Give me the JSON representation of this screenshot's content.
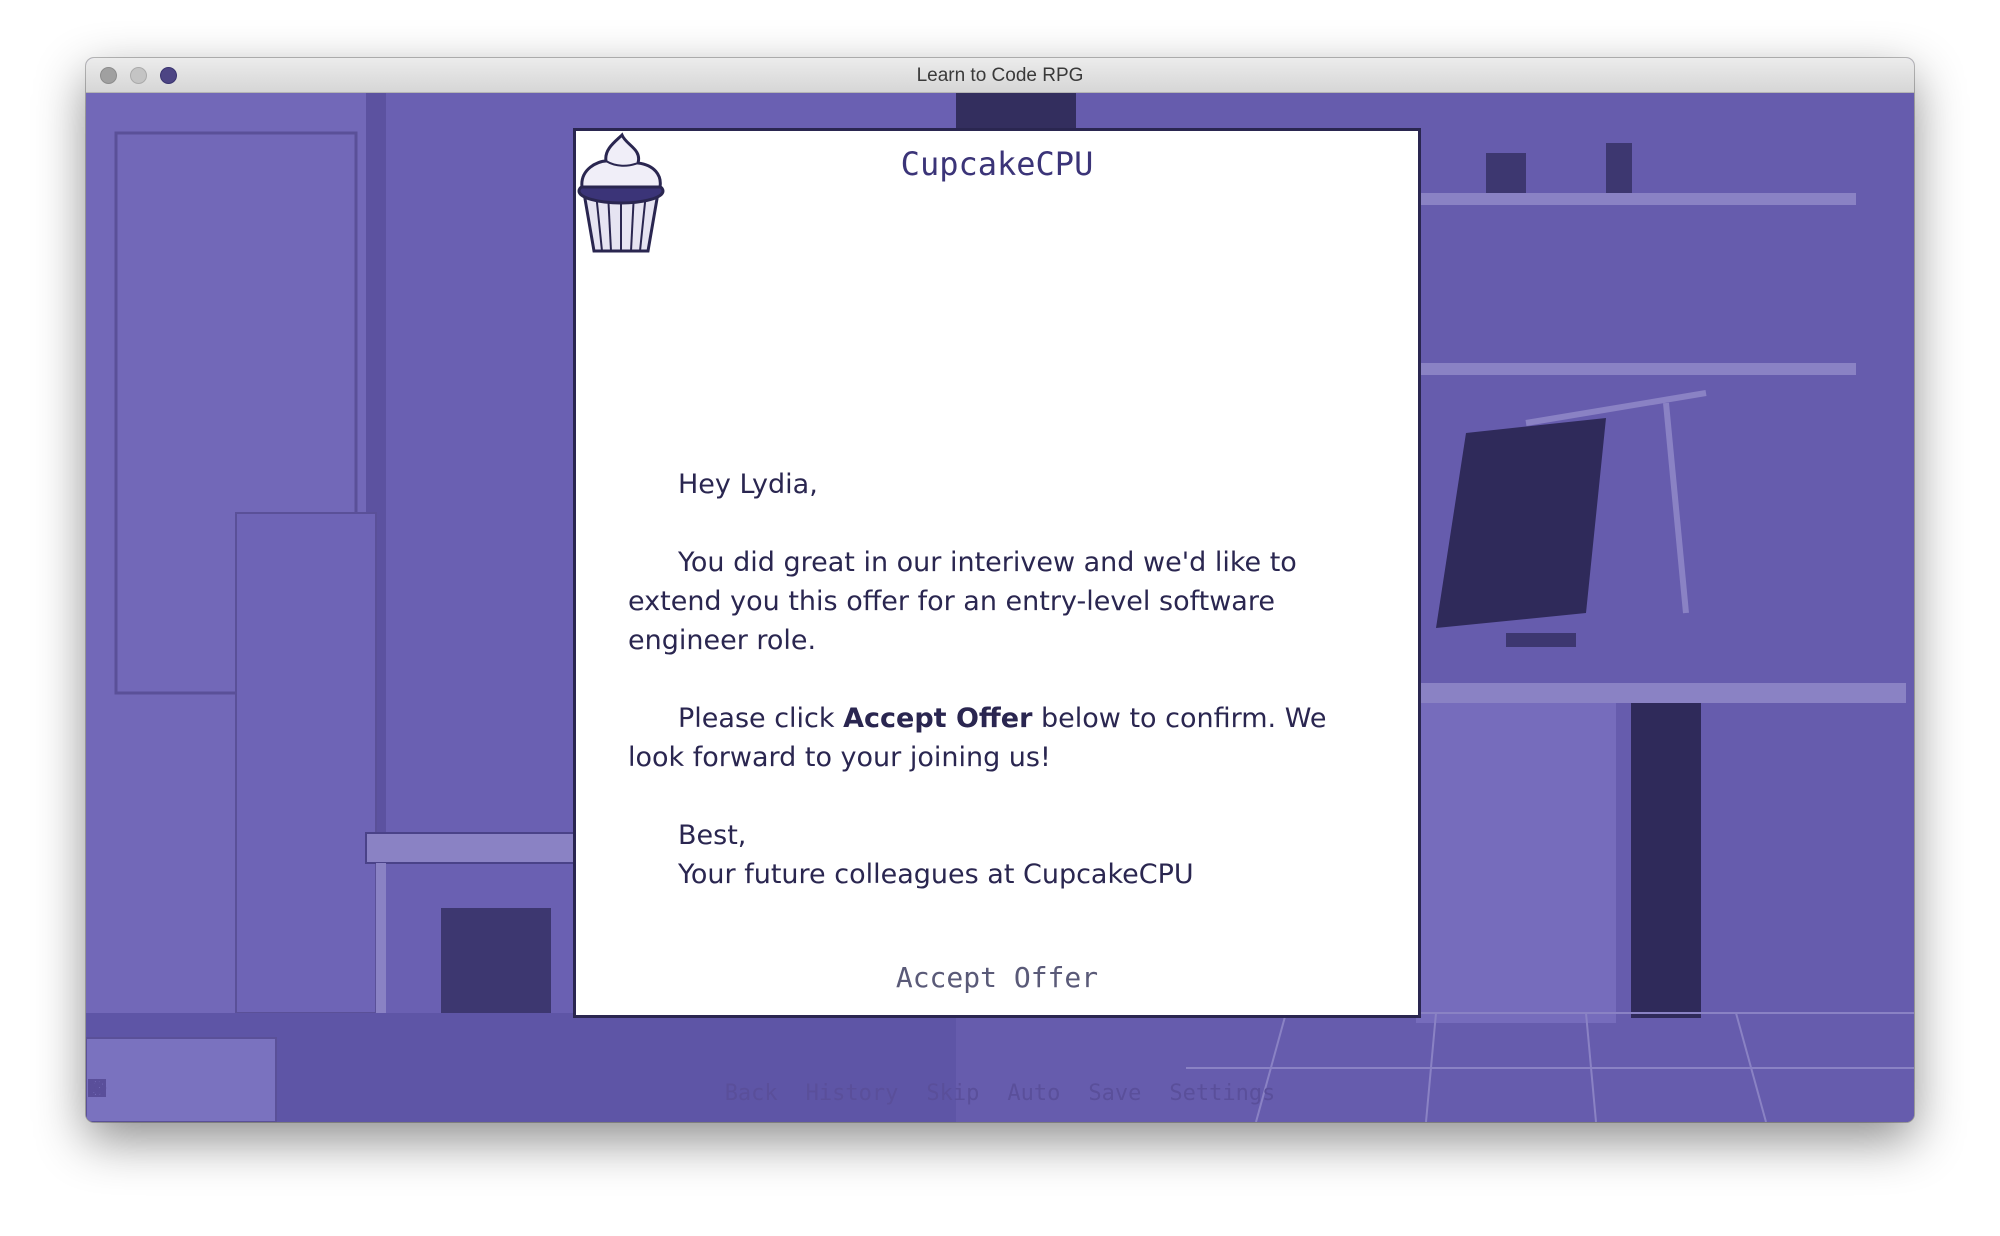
{
  "window": {
    "title": "Learn to Code RPG"
  },
  "letter": {
    "company": "CupcakeCPU",
    "greeting": "Hey Lydia,",
    "paragraph1": "You did great in our interivew and we'd like to extend you this offer for an entry-level software engineer role.",
    "paragraph2_prefix": "Please click ",
    "paragraph2_bold": "Accept Offer",
    "paragraph2_suffix": " below to confirm. We look forward to your joining us!",
    "closing": "Best,",
    "signature": "Your future colleagues at CupcakeCPU",
    "accept_button": "Accept Offer"
  },
  "quick_menu": {
    "items": [
      {
        "label": "Back",
        "icon": "back-icon"
      },
      {
        "label": "History",
        "icon": "history-icon"
      },
      {
        "label": "Skip",
        "icon": "skip-icon"
      },
      {
        "label": "Auto",
        "icon": "auto-icon"
      },
      {
        "label": "Save",
        "icon": "save-icon"
      },
      {
        "label": "Settings",
        "icon": "settings-icon"
      }
    ]
  },
  "colors": {
    "background_tint": "#6a60b2",
    "ink": "#2a2650",
    "accent": "#3b3478"
  }
}
